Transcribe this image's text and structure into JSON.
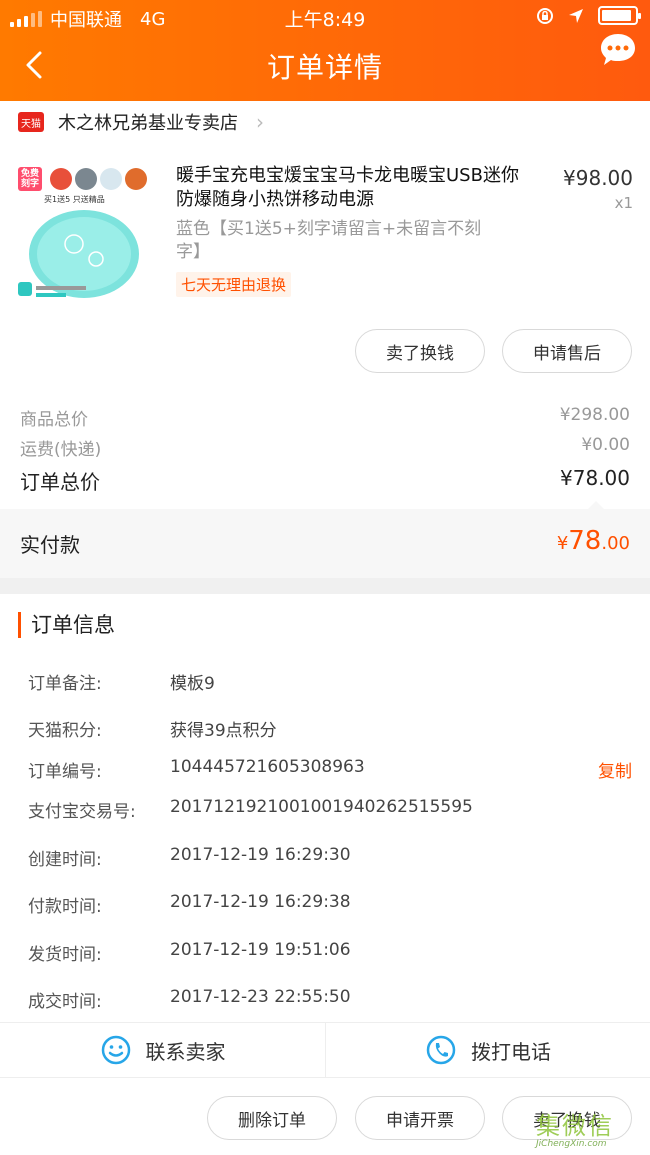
{
  "status_bar": {
    "carrier": "中国联通",
    "network": "4G",
    "time": "上午8:49"
  },
  "header": {
    "title": "订单详情"
  },
  "shop": {
    "badge": "天猫",
    "name": "木之林兄弟基业专卖店"
  },
  "product": {
    "title": "暖手宝充电宝煖宝宝马卡龙电暖宝USB迷你防爆随身小热饼移动电源",
    "spec": "蓝色【买1送5+刻字请留言+未留言不刻字】",
    "tag": "七天无理由退换",
    "price": "¥98.00",
    "qty": "x1",
    "thumb_banner": {
      "badge": "免费刻字",
      "promo": "买1送5 只送精品"
    }
  },
  "item_actions": {
    "sell": "卖了换钱",
    "after_sale": "申请售后"
  },
  "summary": {
    "goods_total_label": "商品总价",
    "goods_total": "¥298.00",
    "shipping_label": "运费(快递)",
    "shipping": "¥0.00",
    "order_total_label": "订单总价",
    "order_total": "¥78.00",
    "paid_label": "实付款",
    "paid_currency": "¥",
    "paid_int": "78",
    "paid_dec": ".00"
  },
  "order_info": {
    "title": "订单信息",
    "rows": [
      {
        "label": "订单备注:",
        "value": "模板9"
      },
      {
        "label": "天猫积分:",
        "value": "获得39点积分"
      },
      {
        "label": "订单编号:",
        "value": "104445721605308963",
        "action": "复制"
      },
      {
        "label": "支付宝交易号:",
        "value": "2017121921001001940262515595"
      },
      {
        "label": "创建时间:",
        "value": "2017-12-19 16:29:30"
      },
      {
        "label": "付款时间:",
        "value": "2017-12-19 16:29:38"
      },
      {
        "label": "发货时间:",
        "value": "2017-12-19 19:51:06"
      },
      {
        "label": "成交时间:",
        "value": "2017-12-23 22:55:50"
      }
    ]
  },
  "contact": {
    "seller": "联系卖家",
    "phone": "拨打电话"
  },
  "bottom_actions": {
    "delete": "删除订单",
    "invoice": "申请开票",
    "sell": "卖了换钱"
  },
  "watermark": {
    "text": "集微信",
    "url": "JiChengXin.com"
  },
  "colors": {
    "accent": "#ff5000",
    "header_from": "#ff7a00",
    "header_to": "#ff5a0e"
  }
}
